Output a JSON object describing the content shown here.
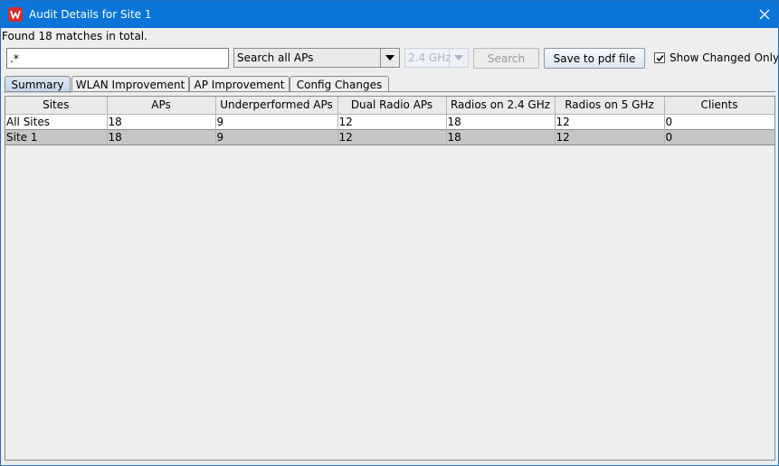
{
  "window": {
    "title": "Audit Details for Site 1"
  },
  "status": {
    "matches_text": "Found 18 matches in total."
  },
  "toolbar": {
    "search_value": ".*",
    "scope_value": "Search all APs",
    "band_value": "2.4 GHz",
    "search_label": "Search",
    "pdf_label": "Save to pdf file",
    "show_changed_label": "Show Changed Only",
    "show_changed_checked": true
  },
  "tabs": [
    {
      "label": "Summary",
      "active": true
    },
    {
      "label": "WLAN Improvement",
      "active": false
    },
    {
      "label": "AP Improvement",
      "active": false
    },
    {
      "label": "Config Changes",
      "active": false
    }
  ],
  "table": {
    "columns": [
      "Sites",
      "APs",
      "Underperformed APs",
      "Dual Radio APs",
      "Radios on 2.4 GHz",
      "Radios on 5 GHz",
      "Clients"
    ],
    "rows": [
      [
        "All Sites",
        "18",
        "9",
        "12",
        "18",
        "12",
        "0"
      ],
      [
        "Site 1",
        "18",
        "9",
        "12",
        "18",
        "12",
        "0"
      ]
    ],
    "selected_row": 1
  },
  "icons": {
    "app": "app-logo-icon",
    "close": "close-icon",
    "dropdown": "chevron-down-icon",
    "check": "checkmark-icon"
  }
}
